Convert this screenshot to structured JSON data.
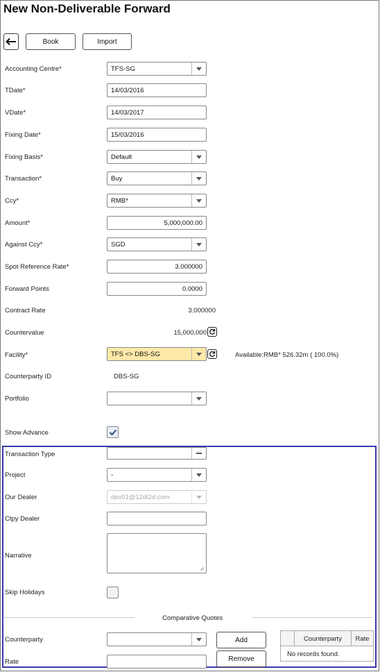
{
  "page_title": "New Non-Deliverable Forward",
  "toolbar": {
    "book_label": "Book",
    "import_label": "Import"
  },
  "form": {
    "accounting_centre": {
      "label": "Accounting Centre*",
      "value": "TFS-SG"
    },
    "tdate": {
      "label": "TDate*",
      "value": "14/03/2016"
    },
    "vdate": {
      "label": "VDate*",
      "value": "14/03/2017"
    },
    "fixing_date": {
      "label": "Fixing Date*",
      "value": "15/03/2016"
    },
    "fixing_basis": {
      "label": "Fixing Basis*",
      "value": "Default"
    },
    "transaction": {
      "label": "Transaction*",
      "value": "Buy"
    },
    "ccy": {
      "label": "Ccy*",
      "value": "RMB*"
    },
    "amount": {
      "label": "Amount*",
      "value": "5,000,000.00"
    },
    "against_ccy": {
      "label": "Against Ccy*",
      "value": "SGD"
    },
    "spot_reference_rate": {
      "label": "Spot Reference Rate*",
      "value": "3.000000"
    },
    "forward_points": {
      "label": "Forward Points",
      "value": "0.0000"
    },
    "contract_rate": {
      "label": "Contract Rate",
      "value": "3.000000"
    },
    "countervalue": {
      "label": "Countervalue",
      "value": "15,000,000"
    },
    "facility": {
      "label": "Facility*",
      "value": "TFS <> DBS-SG",
      "available": "Available:RMB* 526.32m ( 100.0%)"
    },
    "counterparty_id": {
      "label": "Counterparty ID",
      "value": "DBS-SG"
    },
    "portfolio": {
      "label": "Portfolio",
      "value": ""
    },
    "show_advance": {
      "label": "Show Advance",
      "checked": true
    }
  },
  "advanced": {
    "transaction_type": {
      "label": "Transaction Type",
      "value": ""
    },
    "project": {
      "label": "Project",
      "value": "-"
    },
    "our_dealer": {
      "label": "Our Dealer",
      "value": "dev01@12dl2d.com"
    },
    "ctpy_dealer": {
      "label": "Ctpy Dealer",
      "value": ""
    },
    "narrative": {
      "label": "Narrative",
      "value": ""
    },
    "skip_holidays": {
      "label": "Skip Holidays",
      "checked": false
    }
  },
  "comparative_quotes": {
    "title": "Comparative Quotes",
    "counterparty_label": "Counterparty",
    "counterparty_value": "",
    "rate_label": "Rate",
    "rate_value": "",
    "add_label": "Add",
    "remove_label": "Remove",
    "columns": [
      "",
      "Counterparty",
      "Rate"
    ],
    "empty_message": "No records found."
  },
  "colors": {
    "highlight": "#fde9a9",
    "box_border": "#3a3aa8"
  }
}
